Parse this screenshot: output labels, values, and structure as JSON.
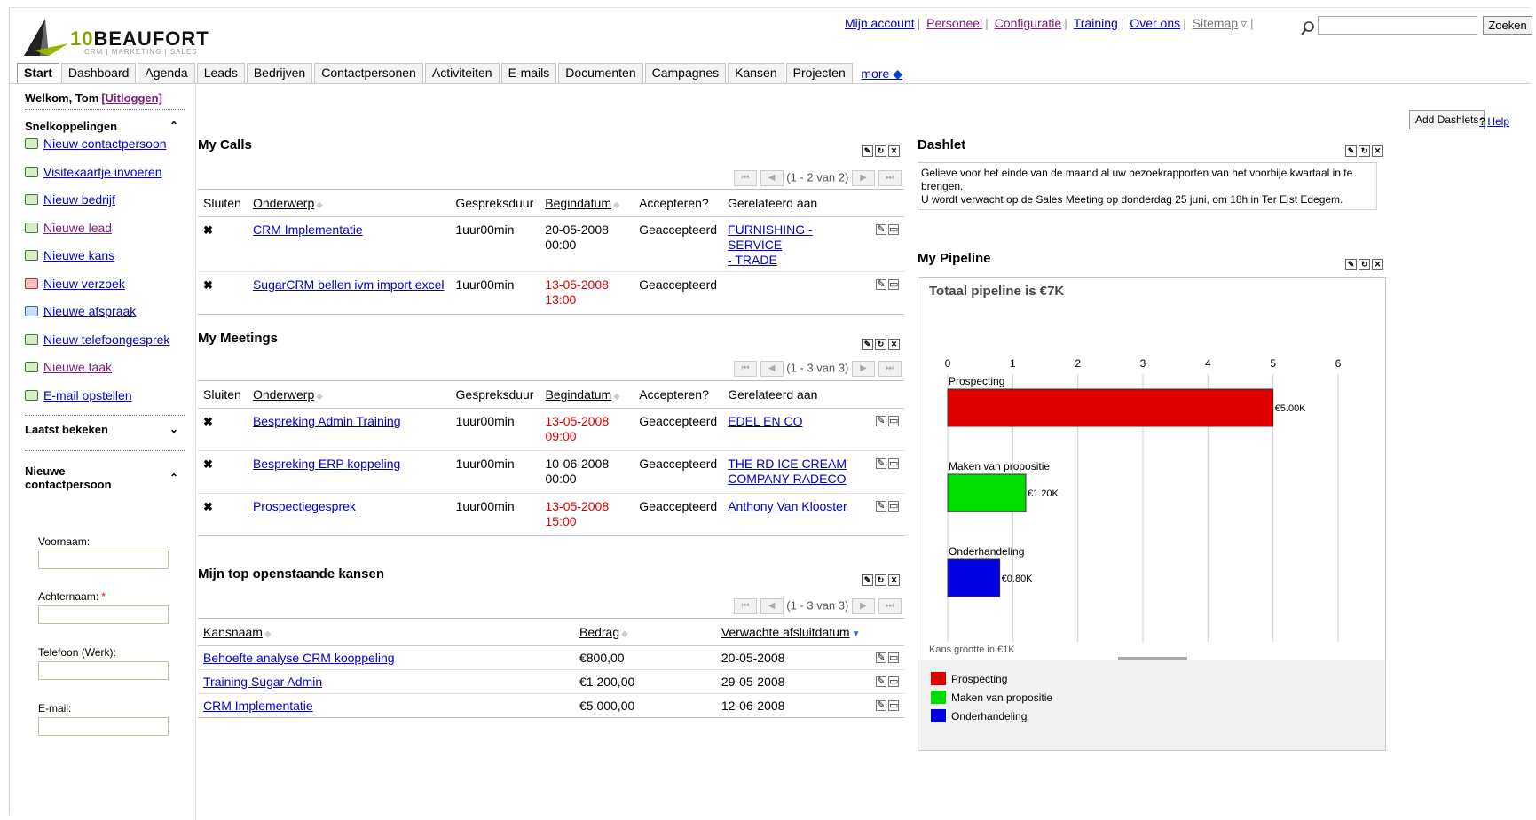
{
  "logo": {
    "name_prefix": "10",
    "name": "BEAUFORT",
    "sub": "CRM | MARKETING | SALES"
  },
  "toplinks": [
    "Mijn account",
    "Personeel",
    "Configuratie",
    "Training",
    "Over ons",
    "Sitemap"
  ],
  "search": {
    "placeholder": "",
    "button": "Zoeken"
  },
  "tabs": [
    "Start",
    "Dashboard",
    "Agenda",
    "Leads",
    "Bedrijven",
    "Contactpersonen",
    "Activiteiten",
    "E-mails",
    "Documenten",
    "Campagnes",
    "Kansen",
    "Projecten"
  ],
  "tabs_more": "more",
  "sidebar": {
    "welcome": "Welkom, Tom",
    "logout": "[Uitloggen]",
    "shortcuts_title": "Snelkoppelingen",
    "shortcuts": [
      "Nieuw contactpersoon",
      "Visitekaartje invoeren",
      "Nieuw bedrijf",
      "Nieuwe lead",
      "Nieuwe kans",
      "Nieuw verzoek",
      "Nieuwe afspraak",
      "Nieuw telefoongesprek",
      "Nieuwe taak",
      "E-mail opstellen"
    ],
    "last_viewed": "Laatst bekeken",
    "new_contact_1": "Nieuwe",
    "new_contact_2": "contactpersoon",
    "form": {
      "first": "Voornaam:",
      "last": "Achternaam:",
      "last_req": "*",
      "phone": "Telefoon (Werk):",
      "email": "E-mail:"
    }
  },
  "add_dashlets": "Add Dashlets",
  "help": "Help",
  "help_q": "?",
  "calls": {
    "title": "My Calls",
    "pager": "(1 - 2 van 2)",
    "headers": [
      "Sluiten",
      "Onderwerp",
      "Gespreksduur",
      "Begindatum",
      "Accepteren?",
      "Gerelateerd aan"
    ],
    "rows": [
      {
        "subject": "CRM Implementatie",
        "duration": "1uur00min",
        "date": "20-05-2008",
        "time": "00:00",
        "overdue": false,
        "accept": "Geaccepteerd",
        "related": "FURNISHING - SERVICE",
        "related2": "- TRADE"
      },
      {
        "subject": "SugarCRM bellen ivm import excel",
        "duration": "1uur00min",
        "date": "13-05-2008",
        "time": "13:00",
        "overdue": true,
        "accept": "Geaccepteerd",
        "related": "",
        "related2": ""
      }
    ]
  },
  "meetings": {
    "title": "My Meetings",
    "pager": "(1 - 3 van 3)",
    "headers": [
      "Sluiten",
      "Onderwerp",
      "Gespreksduur",
      "Begindatum",
      "Accepteren?",
      "Gerelateerd aan"
    ],
    "rows": [
      {
        "subject": "Bespreking Admin Training",
        "duration": "1uur00min",
        "date": "13-05-2008",
        "time": "09:00",
        "overdue": true,
        "accept": "Geaccepteerd",
        "related": "EDEL EN CO",
        "related2": ""
      },
      {
        "subject": "Bespreking ERP koppeling",
        "duration": "1uur00min",
        "date": "10-06-2008",
        "time": "00:00",
        "overdue": false,
        "accept": "Geaccepteerd",
        "related": "THE RD ICE CREAM",
        "related2": "COMPANY RADECO"
      },
      {
        "subject": "Prospectiegesprek",
        "duration": "1uur00min",
        "date": "13-05-2008",
        "time": "15:00",
        "overdue": true,
        "accept": "Geaccepteerd",
        "related": "Anthony Van Klooster",
        "related2": ""
      }
    ]
  },
  "opps": {
    "title": "Mijn top openstaande kansen",
    "pager": "(1 - 3 van 3)",
    "headers": [
      "Kansnaam",
      "Bedrag",
      "Verwachte afsluitdatum"
    ],
    "rows": [
      {
        "name": "Behoefte analyse CRM kooppeling",
        "amount": "€800,00",
        "date": "20-05-2008"
      },
      {
        "name": "Training Sugar Admin",
        "amount": "€1.200,00",
        "date": "29-05-2008"
      },
      {
        "name": "CRM Implementatie",
        "amount": "€5.000,00",
        "date": "12-06-2008"
      }
    ]
  },
  "dashlet": {
    "title": "Dashlet",
    "line1": "Gelieve voor het einde van de maand al uw bezoekrapporten van het voorbije kwartaal in te",
    "line2": "brengen.",
    "line3": "U wordt verwacht op de Sales Meeting op donderdag 25 juni, om 18h in Ter Elst Edegem."
  },
  "pipeline_title": "My Pipeline",
  "colors": {
    "prospecting": "#e00000",
    "proposal": "#00dd00",
    "negotiation": "#0000e0"
  },
  "chart_data": {
    "type": "bar",
    "orientation": "horizontal",
    "title": "Totaal pipeline is €7K",
    "xlabel": "Kans grootte in €1K",
    "xlim": [
      0,
      6
    ],
    "ticks": [
      "0",
      "1",
      "2",
      "3",
      "4",
      "5",
      "6"
    ],
    "categories": [
      "Prospecting",
      "Maken van propositie",
      "Onderhandeling"
    ],
    "values": [
      5.0,
      1.2,
      0.8
    ],
    "value_labels": [
      "€5.00K",
      "€1.20K",
      "€0.80K"
    ],
    "colors": [
      "#e00000",
      "#00dd00",
      "#0000e0"
    ],
    "legend": [
      "Prospecting",
      "Maken van propositie",
      "Onderhandeling"
    ],
    "legend_position": "bottom",
    "grid": true
  }
}
